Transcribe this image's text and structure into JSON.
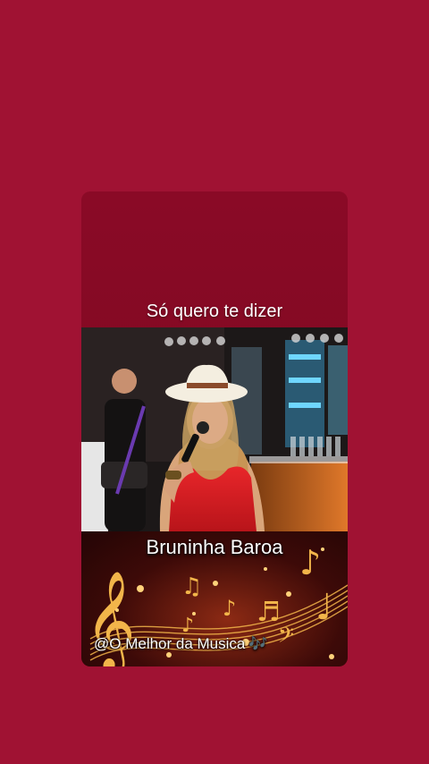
{
  "lyric_line": "Só quero te dizer",
  "artist_name": "Bruninha Baroa",
  "channel_handle": "@O Melhor da Musica",
  "handle_emoji": "🎶",
  "colors": {
    "page_background": "#a01233",
    "card_background": "#8a0a26",
    "text": "#ffffff",
    "notes_gold": "#f2b54a"
  },
  "icons": [
    "music-notes-emoji",
    "treble-clef-icon",
    "music-staff-decoration"
  ]
}
